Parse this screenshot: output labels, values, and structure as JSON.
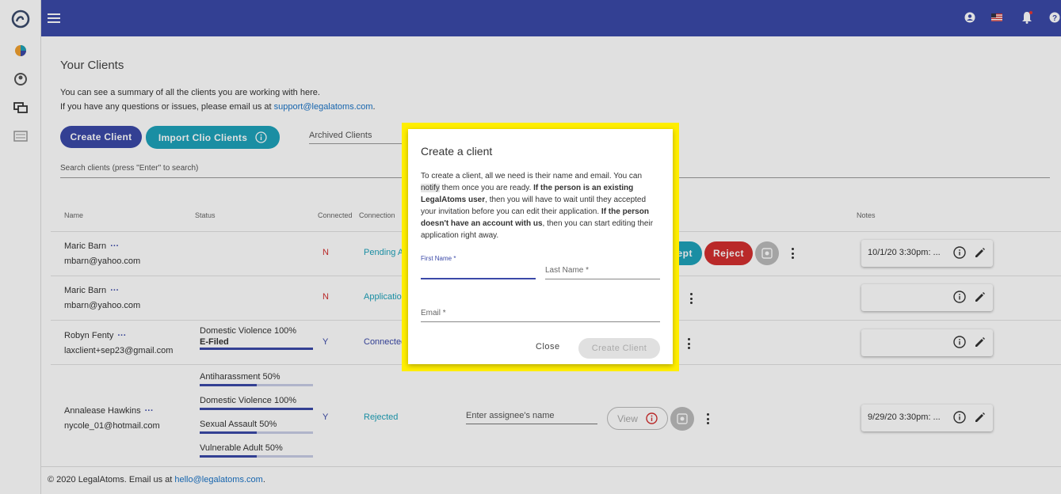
{
  "app": {
    "brand": "LegalAtoms"
  },
  "header": {
    "notification_badge": ""
  },
  "page": {
    "title": "Your Clients",
    "desc_line1": "You can see a summary of all the clients you are working with here.",
    "desc_line2_prefix": "If you have any questions or issues, please email us at ",
    "support_email": "support@legalatoms.com",
    "desc_line2_suffix": ".",
    "create_client_label": "Create Client",
    "import_clio_label": "Import Clio Clients",
    "archived_label": "Archived Clients",
    "search_placeholder": "Search clients (press \"Enter\" to search)"
  },
  "table": {
    "columns": [
      "Name",
      "Status",
      "Connected",
      "Connection",
      "Notes"
    ],
    "rows": [
      {
        "name": "Maric Barn",
        "email": "mbarn@yahoo.com",
        "connected": "N",
        "connection": "Pending A",
        "note": "10/1/20 3:30pm: ..."
      },
      {
        "name": "Maric Barn",
        "email": "mbarn@yahoo.com",
        "connected": "N",
        "connection": "Application",
        "note": ""
      },
      {
        "name": "Robyn Fenty",
        "email": "laxclient+sep23@gmail.com",
        "connected": "Y",
        "connection": "Connected",
        "note": "",
        "status_label": "Domestic Violence 100%",
        "status_sub": "E-Filed",
        "status_pct": 100
      },
      {
        "name": "Annalease Hawkins",
        "email": "nycole_01@hotmail.com",
        "connected": "Y",
        "connection": "Rejected",
        "note": "9/29/20 3:30pm: ...",
        "statuses": [
          {
            "label": "Antiharassment 50%",
            "pct": 50
          },
          {
            "label": "Domestic Violence 100%",
            "pct": 100
          },
          {
            "label": "Sexual Assault 50%",
            "pct": 50
          },
          {
            "label": "Vulnerable Adult 50%",
            "pct": 50
          }
        ],
        "assignee_placeholder": "Enter assignee's name",
        "view_label": "View"
      }
    ],
    "accept_label": "ept",
    "reject_label": "Reject",
    "more_dots": "···"
  },
  "dialog": {
    "title": "Create a client",
    "text_1": "To create a client, all we need is their name and email. You can ",
    "text_notify": "notify",
    "text_2": " them once you are ready. ",
    "text_bold1": "If the person is an existing LegalAtoms user",
    "text_3": ", then you will have to wait until they accepted your invitation before you can edit their application. ",
    "text_bold2": "If the person doesn't have an account with us",
    "text_4": ", then you can start editing their application right away.",
    "first_name_label": "First Name *",
    "last_name_label": "Last Name *",
    "email_label": "Email *",
    "close_label": "Close",
    "create_label": "Create Client"
  },
  "footer": {
    "copyright": "© 2020 LegalAtoms.  Email us at ",
    "email": "hello@legalatoms.com",
    "suffix": "."
  },
  "colors": {
    "primary": "#3b49a8",
    "teal": "#1ea2ba",
    "red": "#d32f2f",
    "highlight": "#ffee00"
  }
}
